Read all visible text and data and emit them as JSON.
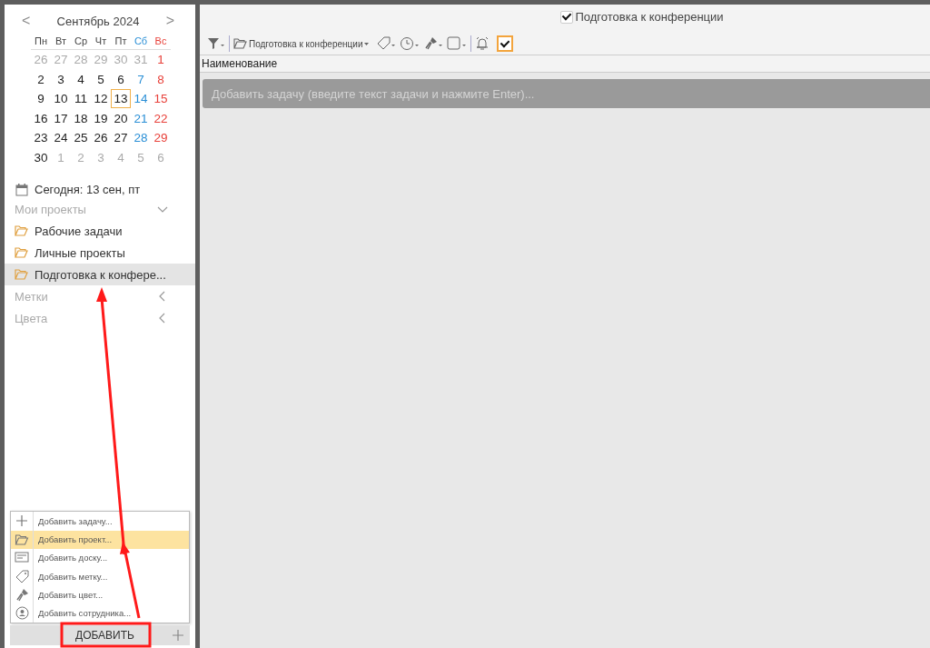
{
  "calendar": {
    "month": "Сентябрь 2024",
    "prev": "<",
    "next": ">",
    "weekdays": [
      "Пн",
      "Вт",
      "Ср",
      "Чт",
      "Пт",
      "Сб",
      "Вс"
    ],
    "weeks": [
      [
        {
          "day": "26",
          "muted": true,
          "selected": false
        },
        {
          "day": "27",
          "muted": true,
          "selected": false
        },
        {
          "day": "28",
          "muted": true,
          "selected": false
        },
        {
          "day": "29",
          "muted": true,
          "selected": false
        },
        {
          "day": "30",
          "muted": true,
          "selected": false
        },
        {
          "day": "31",
          "muted": true,
          "selected": false
        },
        {
          "day": "1",
          "muted": false,
          "selected": false
        }
      ],
      [
        {
          "day": "2",
          "muted": false,
          "selected": false
        },
        {
          "day": "3",
          "muted": false,
          "selected": false
        },
        {
          "day": "4",
          "muted": false,
          "selected": false
        },
        {
          "day": "5",
          "muted": false,
          "selected": false
        },
        {
          "day": "6",
          "muted": false,
          "selected": false
        },
        {
          "day": "7",
          "muted": false,
          "selected": false
        },
        {
          "day": "8",
          "muted": false,
          "selected": false
        }
      ],
      [
        {
          "day": "9",
          "muted": false,
          "selected": false
        },
        {
          "day": "10",
          "muted": false,
          "selected": false
        },
        {
          "day": "11",
          "muted": false,
          "selected": false
        },
        {
          "day": "12",
          "muted": false,
          "selected": false
        },
        {
          "day": "13",
          "muted": false,
          "selected": true
        },
        {
          "day": "14",
          "muted": false,
          "selected": false
        },
        {
          "day": "15",
          "muted": false,
          "selected": false
        }
      ],
      [
        {
          "day": "16",
          "muted": false,
          "selected": false
        },
        {
          "day": "17",
          "muted": false,
          "selected": false
        },
        {
          "day": "18",
          "muted": false,
          "selected": false
        },
        {
          "day": "19",
          "muted": false,
          "selected": false
        },
        {
          "day": "20",
          "muted": false,
          "selected": false
        },
        {
          "day": "21",
          "muted": false,
          "selected": false
        },
        {
          "day": "22",
          "muted": false,
          "selected": false
        }
      ],
      [
        {
          "day": "23",
          "muted": false,
          "selected": false
        },
        {
          "day": "24",
          "muted": false,
          "selected": false
        },
        {
          "day": "25",
          "muted": false,
          "selected": false
        },
        {
          "day": "26",
          "muted": false,
          "selected": false
        },
        {
          "day": "27",
          "muted": false,
          "selected": false
        },
        {
          "day": "28",
          "muted": false,
          "selected": false
        },
        {
          "day": "29",
          "muted": false,
          "selected": false
        }
      ],
      [
        {
          "day": "30",
          "muted": false,
          "selected": false
        },
        {
          "day": "1",
          "muted": true,
          "selected": false
        },
        {
          "day": "2",
          "muted": true,
          "selected": false
        },
        {
          "day": "3",
          "muted": true,
          "selected": false
        },
        {
          "day": "4",
          "muted": true,
          "selected": false
        },
        {
          "day": "5",
          "muted": true,
          "selected": false
        },
        {
          "day": "6",
          "muted": true,
          "selected": false
        }
      ]
    ]
  },
  "today": "Сегодня: 13 сен, пт",
  "sections": [
    {
      "title": "Мои проекты",
      "expanded": true,
      "items": [
        {
          "label": "Рабочие задачи",
          "selected": false
        },
        {
          "label": "Личные проекты",
          "selected": false
        },
        {
          "label": "Подготовка к конфере...",
          "selected": true
        }
      ]
    },
    {
      "title": "Метки",
      "expanded": false
    },
    {
      "title": "Цвета",
      "expanded": false
    }
  ],
  "add_menu": [
    {
      "kind": "task",
      "label": "Добавить задачу...",
      "selected": false
    },
    {
      "kind": "project",
      "label": "Добавить проект...",
      "selected": true
    },
    {
      "kind": "board",
      "label": "Добавить доску...",
      "selected": false
    },
    {
      "kind": "tag",
      "label": "Добавить метку...",
      "selected": false
    },
    {
      "kind": "color",
      "label": "Добавить цвет...",
      "selected": false
    },
    {
      "kind": "person",
      "label": "Добавить сотрудника...",
      "selected": false
    }
  ],
  "add_button": "ДОБАВИТЬ",
  "header": {
    "checked": true,
    "title": "Подготовка к конференции"
  },
  "toolbar": {
    "project": "Подготовка к конференции",
    "done_filter": true
  },
  "column": "Наименование",
  "new_task": {
    "placeholder": "Добавить задачу (введите текст задачи и нажмите Enter)..."
  }
}
